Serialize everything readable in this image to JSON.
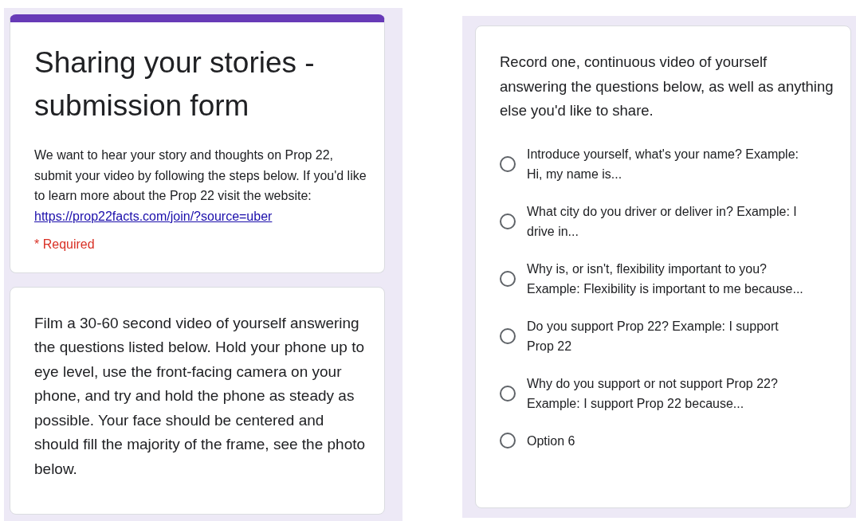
{
  "header_card": {
    "title": "Sharing your stories - submission form",
    "description": "We want to hear your story and thoughts on Prop 22, submit your video by following the steps below. If you'd like to learn more about the Prop 22 visit the website:",
    "link": "https://prop22facts.com/join/?source=uber",
    "required_note": "* Required"
  },
  "instructions_card": {
    "text": "Film a 30-60 second video of yourself answering the questions listed below. Hold your phone up to eye level, use the front-facing camera on your phone, and try and hold the phone as steady as possible. Your face should be centered and should fill the majority of the frame, see the photo below."
  },
  "question_card": {
    "prompt": "Record one, continuous video of yourself answering the questions below, as well as anything else you'd like to share.",
    "options": [
      {
        "label": "Introduce yourself, what's your name? Example: Hi, my name is...",
        "selected": false
      },
      {
        "label": "What city do you driver or deliver in? Example: I drive in...",
        "selected": false
      },
      {
        "label": "Why is, or isn't, flexibility important to you? Example: Flexibility is important to me because...",
        "selected": false
      },
      {
        "label": "Do you support Prop 22? Example: I support Prop 22",
        "selected": false
      },
      {
        "label": "Why do you support or not support Prop 22? Example: I support Prop 22 because...",
        "selected": false
      },
      {
        "label": "Option 6",
        "selected": false
      }
    ]
  }
}
